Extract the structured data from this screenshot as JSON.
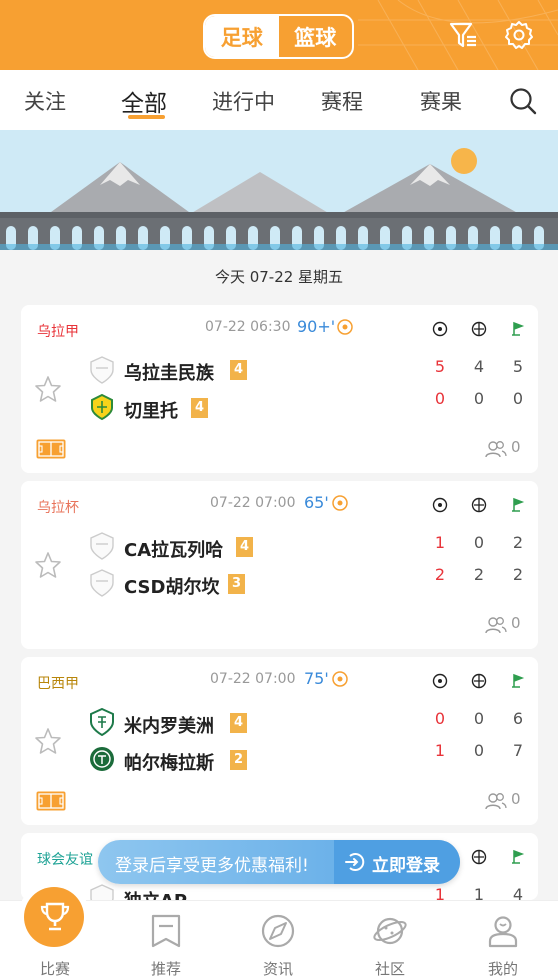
{
  "header": {
    "sport_tabs": [
      "足球",
      "篮球"
    ],
    "active_sport": "足球"
  },
  "tabs": {
    "items": [
      "关注",
      "全部",
      "进行中",
      "赛程",
      "赛果"
    ],
    "active": "全部"
  },
  "date_line": "今天 07-22 星期五",
  "matches": [
    {
      "league": "乌拉甲",
      "league_color": "#e8343a",
      "time": "07-22 06:30",
      "minute": "90+'",
      "home": {
        "name": "乌拉圭民族",
        "rank": "4"
      },
      "away": {
        "name": "切里托",
        "rank": "4"
      },
      "home_scores": [
        "5",
        "4",
        "5"
      ],
      "away_scores": [
        "0",
        "0",
        "0"
      ],
      "people_count": "0"
    },
    {
      "league": "乌拉杯",
      "league_color": "#e8735a",
      "time": "07-22 07:00",
      "minute": "65'",
      "home": {
        "name": "CA拉瓦列哈",
        "rank": "4"
      },
      "away": {
        "name": "CSD胡尔坎",
        "rank": "3"
      },
      "home_scores": [
        "1",
        "0",
        "2"
      ],
      "away_scores": [
        "2",
        "2",
        "2"
      ],
      "people_count": "0"
    },
    {
      "league": "巴西甲",
      "league_color": "#b8860b",
      "time": "07-22 07:00",
      "minute": "75'",
      "home": {
        "name": "米内罗美洲",
        "rank": "4"
      },
      "away": {
        "name": "帕尔梅拉斯",
        "rank": "2"
      },
      "home_scores": [
        "0",
        "0",
        "6"
      ],
      "away_scores": [
        "1",
        "0",
        "7"
      ],
      "people_count": "0"
    },
    {
      "league": "球会友谊",
      "league_color": "#1fa396",
      "home": {
        "name": "独立AP"
      },
      "home_scores": [
        "1",
        "1",
        "4"
      ]
    }
  ],
  "login_banner": {
    "text": "登录后享受更多优惠福利!",
    "button": "立即登录"
  },
  "bottom_nav": {
    "items": [
      "比赛",
      "推荐",
      "资讯",
      "社区",
      "我的"
    ],
    "active": "比赛"
  }
}
